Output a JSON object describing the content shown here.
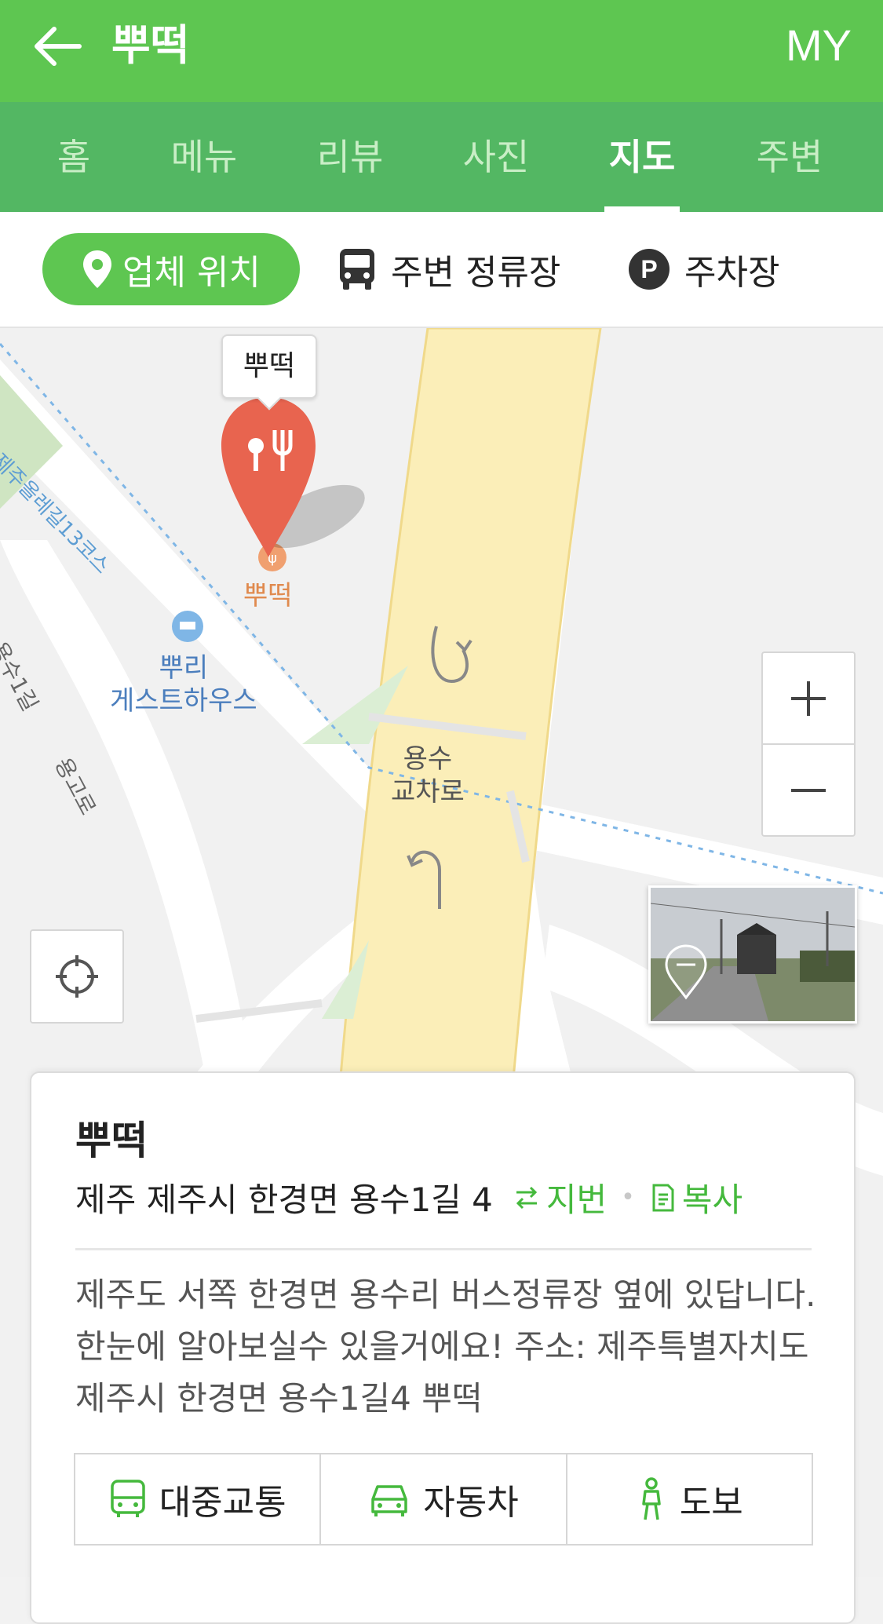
{
  "header": {
    "title": "뿌떡",
    "my_label": "MY"
  },
  "tabs": [
    {
      "label": "홈"
    },
    {
      "label": "메뉴"
    },
    {
      "label": "리뷰"
    },
    {
      "label": "사진"
    },
    {
      "label": "지도",
      "active": true
    },
    {
      "label": "주변"
    }
  ],
  "subtabs": {
    "location": "업체 위치",
    "bus_stop": "주변 정류장",
    "parking": "주차장",
    "parking_icon_letter": "P"
  },
  "map": {
    "marker_tooltip": "뿌떡",
    "poi_label": "뿌떡",
    "guesthouse": [
      "뿌리",
      "게스트하우스"
    ],
    "trail_label": "제주올레길13코스",
    "road_yongsu1": "용수1길",
    "road_yonggo": "용고로",
    "intersection": [
      "용수",
      "교차로"
    ],
    "accent_color": "#5ec651",
    "marker_color": "#e8644f"
  },
  "card": {
    "title": "뿌떡",
    "address": "제주 제주시 한경면 용수1길 4",
    "jibun_label": "지번",
    "copy_label": "복사",
    "description": "제주도 서쪽 한경면 용수리 버스정류장 옆에 있답니다. 한눈에 알아보실수 있을거에요! 주소: 제주특별자치도 제주시 한경면 용수1길4 뿌떡",
    "transport": [
      "대중교통",
      "자동차",
      "도보"
    ]
  }
}
